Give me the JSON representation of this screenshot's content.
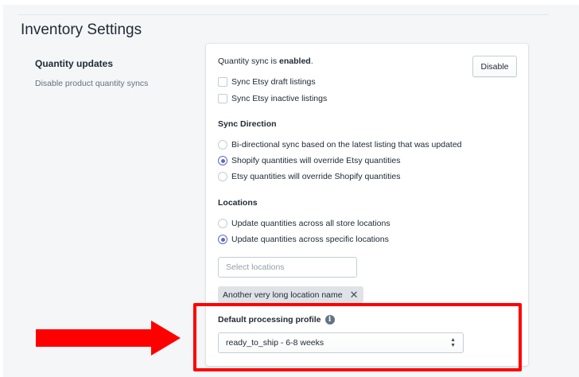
{
  "page": {
    "title": "Inventory Settings"
  },
  "section": {
    "title": "Quantity updates",
    "description": "Disable product quantity syncs"
  },
  "card": {
    "status_prefix": "Quantity sync is ",
    "status_value": "enabled",
    "status_suffix": ".",
    "disable_label": "Disable",
    "checkboxes": [
      {
        "label": "Sync Etsy draft listings",
        "checked": false
      },
      {
        "label": "Sync Etsy inactive listings",
        "checked": false
      }
    ],
    "sync_direction": {
      "heading": "Sync Direction",
      "options": [
        {
          "label": "Bi-directional sync based on the latest listing that was updated",
          "selected": false
        },
        {
          "label": "Shopify quantities will override Etsy quantities",
          "selected": true
        },
        {
          "label": "Etsy quantities will override Shopify quantities",
          "selected": false
        }
      ]
    },
    "locations": {
      "heading": "Locations",
      "options": [
        {
          "label": "Update quantities across all store locations",
          "selected": false
        },
        {
          "label": "Update quantities across specific locations",
          "selected": true
        }
      ],
      "placeholder": "Select locations",
      "tag": "Another very long location name"
    },
    "processing": {
      "heading": "Default processing profile",
      "info_icon": "i",
      "value": "ready_to_ship - 6-8 weeks"
    }
  },
  "annotation": {
    "color": "#ff0000"
  }
}
